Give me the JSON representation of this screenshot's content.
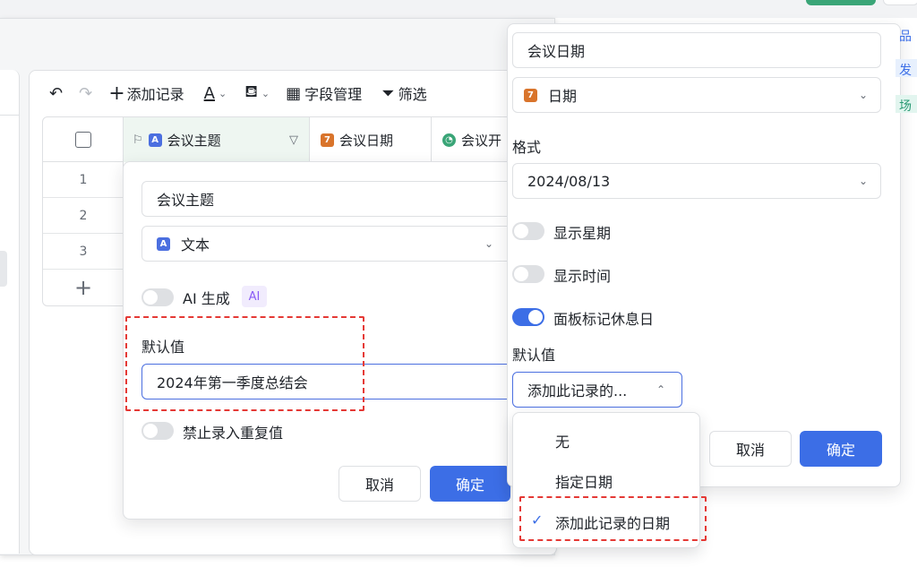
{
  "toolbar": {
    "add_record": "添加记录",
    "field_manage": "字段管理",
    "filter": "筛选"
  },
  "grid": {
    "headers": [
      "会议主题",
      "会议日期",
      "会议开"
    ],
    "rows": [
      "1",
      "2",
      "3"
    ]
  },
  "text_field_panel": {
    "field_name": "会议主题",
    "field_type": "文本",
    "ai_label": "AI 生成",
    "ai_tag": "AI",
    "default_label": "默认值",
    "default_value": "2024年第一季度总结会",
    "no_dup_label": "禁止录入重复值",
    "cancel": "取消",
    "confirm": "确定"
  },
  "date_field_panel": {
    "field_name": "会议日期",
    "field_type": "日期",
    "format_label": "格式",
    "format_value": "2024/08/13",
    "show_weekday": "显示星期",
    "show_time": "显示时间",
    "mark_holiday": "面板标记休息日",
    "default_label": "默认值",
    "default_value": "添加此记录的...",
    "cancel": "取消",
    "confirm": "确定",
    "toggles": {
      "show_weekday": false,
      "show_time": false,
      "mark_holiday": true
    }
  },
  "default_menu": {
    "options": [
      "无",
      "指定日期",
      "添加此记录的日期"
    ],
    "selected": "添加此记录的日期"
  },
  "edge_glyphs": [
    "品",
    "发",
    "场"
  ],
  "colors": {
    "primary": "#3c6ee6",
    "highlight_border": "#e53935",
    "text_icon": "#4b6fe0",
    "date_icon": "#d9742b",
    "time_icon": "#3aa577"
  }
}
